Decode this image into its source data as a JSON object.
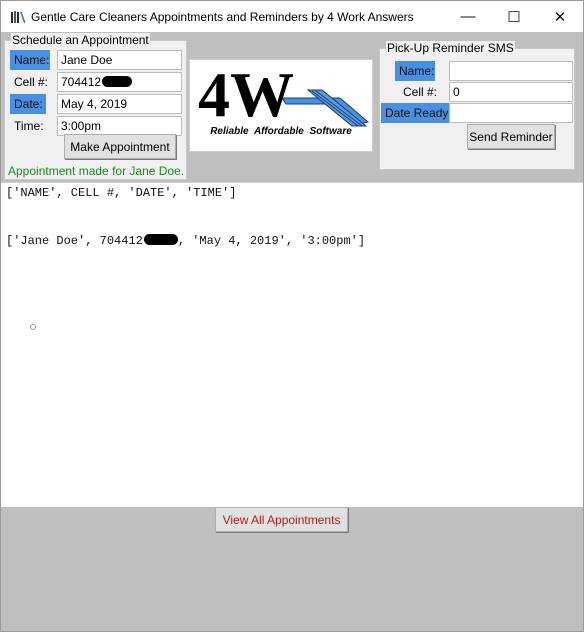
{
  "window": {
    "title": "Gentle Care Cleaners Appointments and Reminders by 4 Work Answers",
    "app_icon": "books-icon",
    "minimize_glyph": "—",
    "maximize_glyph": "☐",
    "close_glyph": "✕"
  },
  "schedule": {
    "frame_title": "Schedule an Appointment",
    "name_label": "Name:",
    "name_value": "Jane Doe",
    "cell_label": "Cell #:",
    "cell_value": "704412",
    "date_label": "Date:",
    "date_value": "May 4, 2019",
    "time_label": "Time:",
    "time_value": "3:00pm",
    "button_label": "Make Appointment",
    "status_text": "Appointment made for Jane Doe."
  },
  "logo": {
    "mark": "4W",
    "tagline": "Reliable Affordable Software"
  },
  "reminder": {
    "frame_title": "Pick-Up Reminder SMS",
    "name_label": "Name:",
    "name_value": "",
    "cell_label": "Cell #:",
    "cell_value": "0",
    "date_ready_label": "Date Ready:",
    "date_ready_value": "",
    "button_label": "Send Reminder"
  },
  "output": {
    "header_line": "['NAME', CELL #, 'DATE', 'TIME']",
    "row_prefix": "['Jane Doe', 704412",
    "row_suffix": ", 'May 4, 2019', '3:00pm']"
  },
  "bottom": {
    "view_all_label": "View All Appointments",
    "view_all_color": "#c01818"
  },
  "colors": {
    "label_highlight": "#4a90e2",
    "status_green": "#1e8a1e",
    "panel_gray": "#bfbfbf"
  }
}
